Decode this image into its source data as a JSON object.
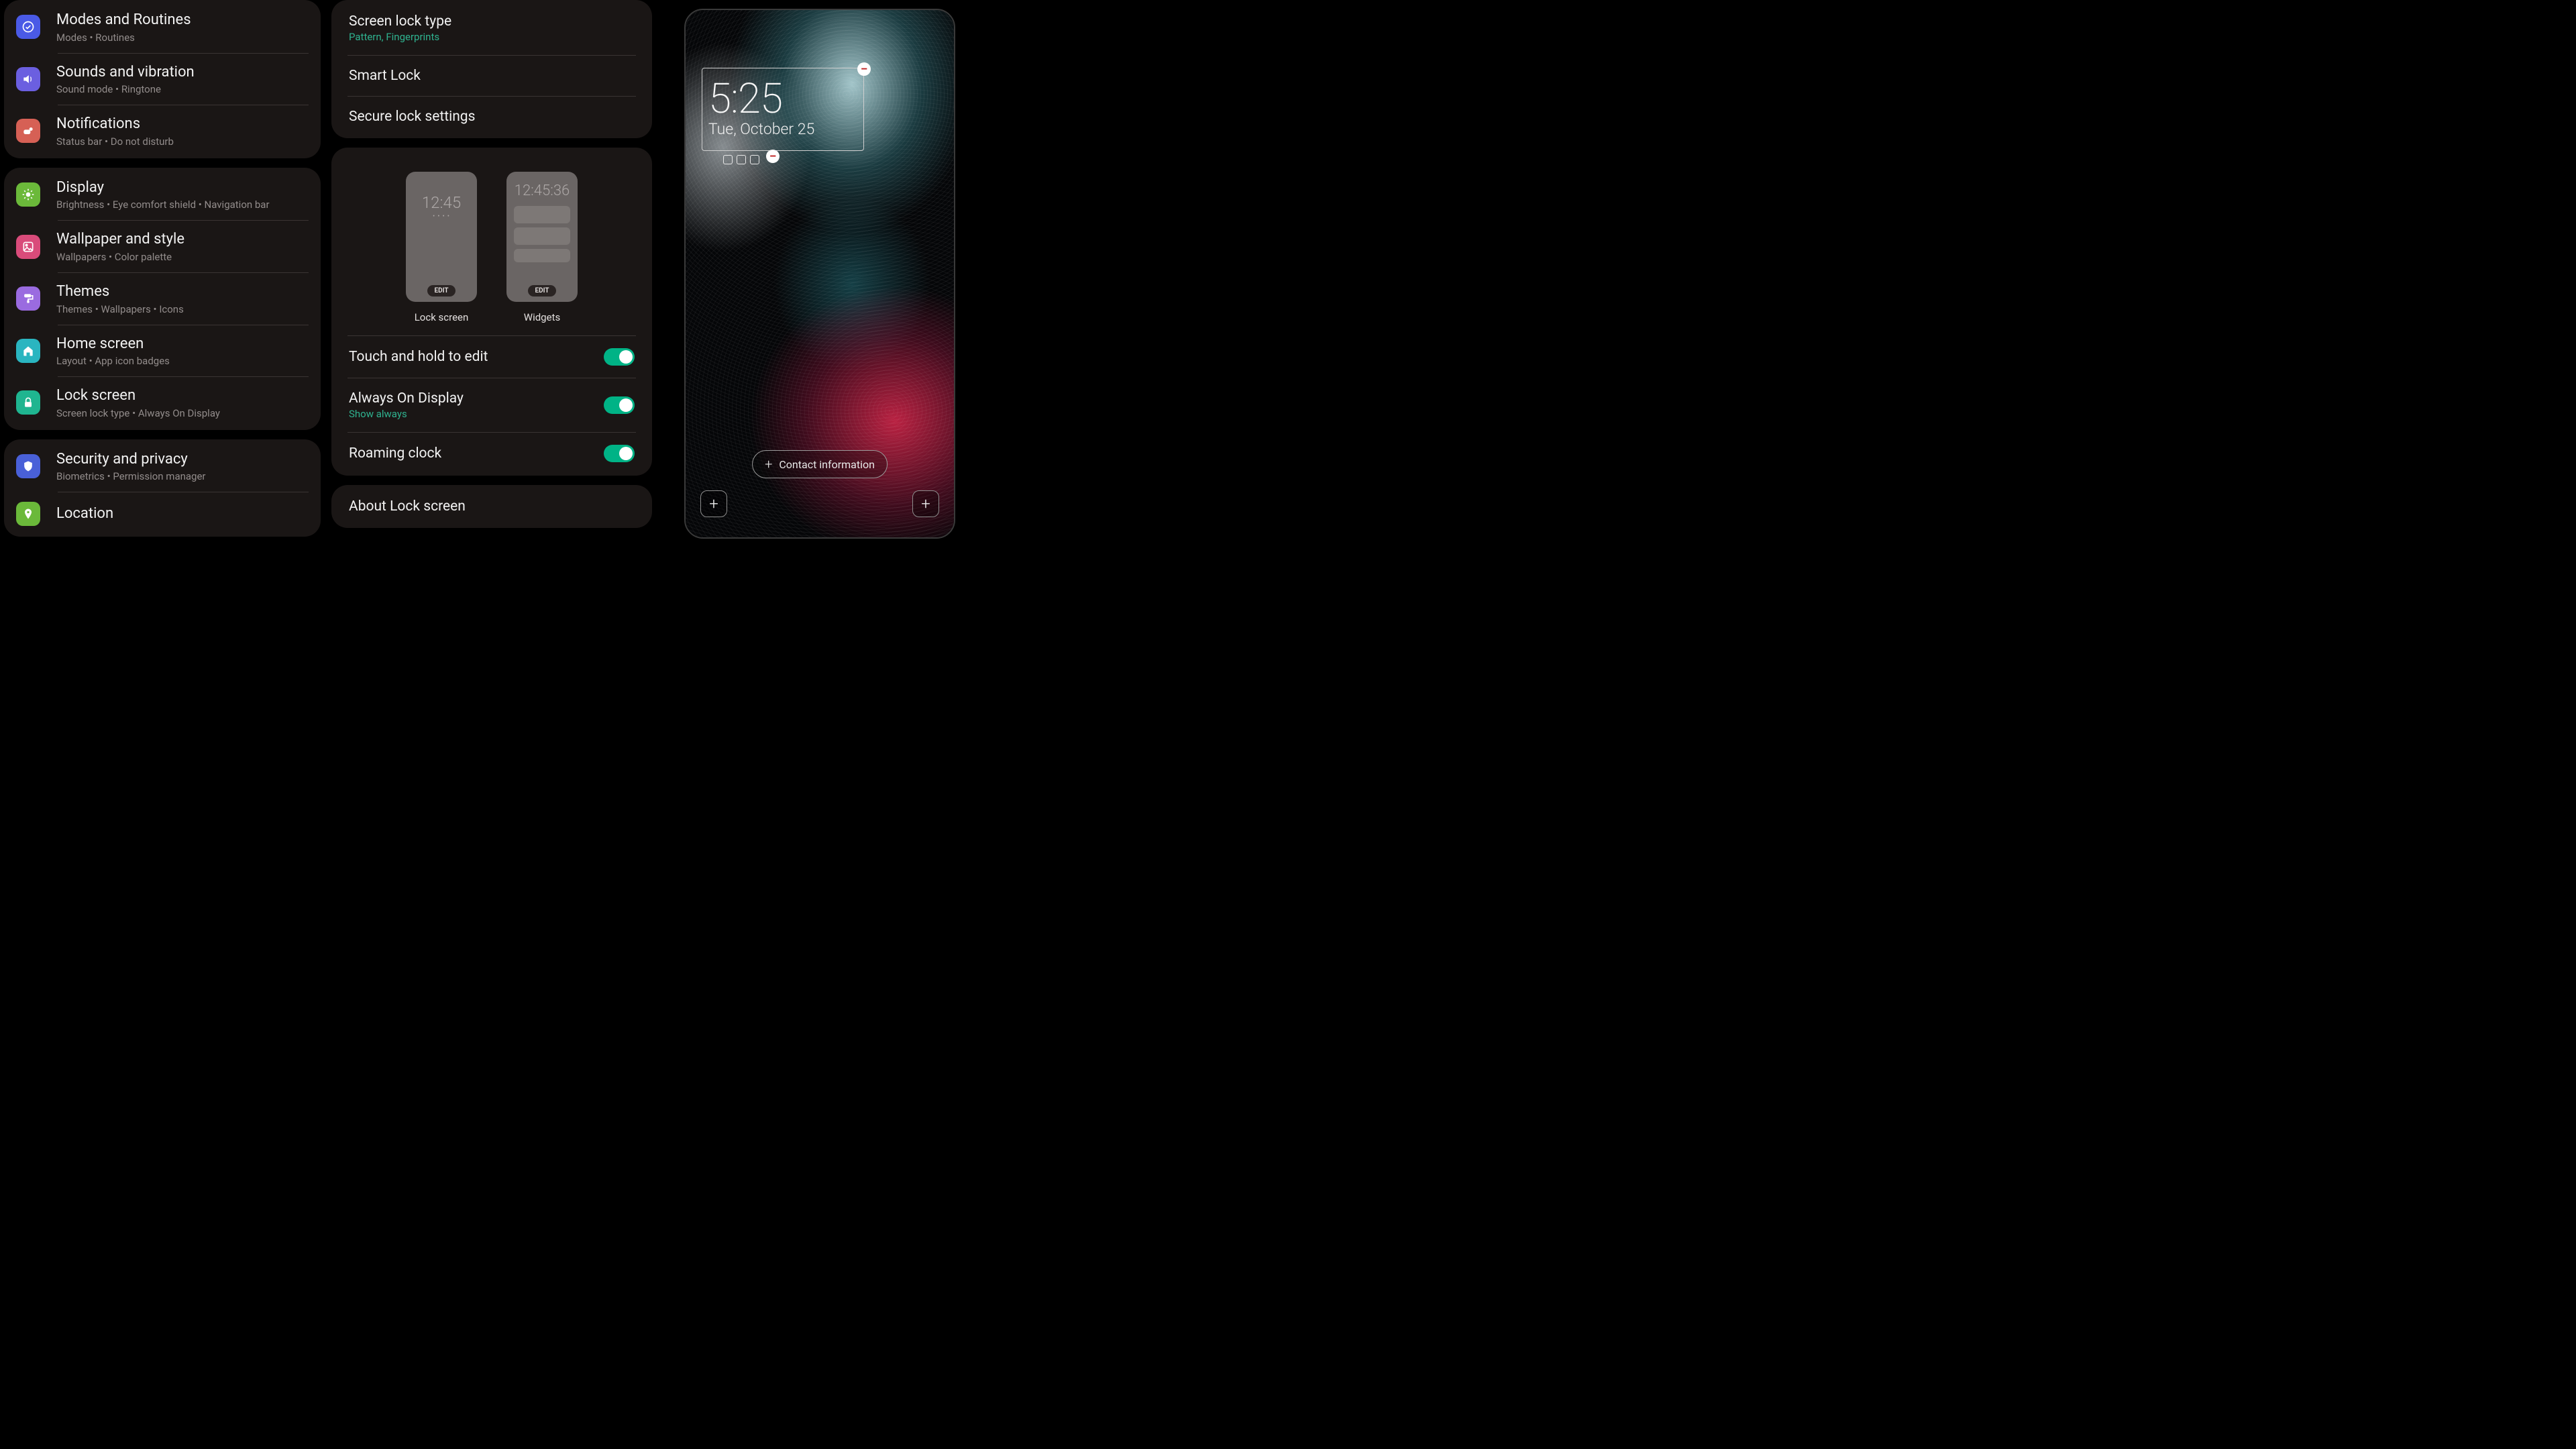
{
  "settings": {
    "group1": [
      {
        "title": "Modes and Routines",
        "subtitle": "Modes  •  Routines"
      },
      {
        "title": "Sounds and vibration",
        "subtitle": "Sound mode  •  Ringtone"
      },
      {
        "title": "Notifications",
        "subtitle": "Status bar  •  Do not disturb"
      }
    ],
    "group2": [
      {
        "title": "Display",
        "subtitle": "Brightness  •  Eye comfort shield  •  Navigation bar"
      },
      {
        "title": "Wallpaper and style",
        "subtitle": "Wallpapers  •  Color palette"
      },
      {
        "title": "Themes",
        "subtitle": "Themes  •  Wallpapers  •  Icons"
      },
      {
        "title": "Home screen",
        "subtitle": "Layout  •  App icon badges"
      },
      {
        "title": "Lock screen",
        "subtitle": "Screen lock type  •  Always On Display"
      }
    ],
    "group3": [
      {
        "title": "Security and privacy",
        "subtitle": "Biometrics  •  Permission manager"
      },
      {
        "title": "Location",
        "subtitle": ""
      }
    ]
  },
  "lockSettings": {
    "screenLockType": {
      "title": "Screen lock type",
      "value": "Pattern, Fingerprints"
    },
    "smartLock": "Smart Lock",
    "secureLock": "Secure lock settings",
    "previews": {
      "lock": {
        "time": "12:45",
        "edit": "EDIT",
        "label": "Lock screen"
      },
      "widgets": {
        "time": "12:45:36",
        "edit": "EDIT",
        "label": "Widgets"
      }
    },
    "touchHold": {
      "title": "Touch and hold to edit",
      "on": true
    },
    "aod": {
      "title": "Always On Display",
      "value": "Show always",
      "on": true
    },
    "roaming": {
      "title": "Roaming clock",
      "on": true
    },
    "about": "About Lock screen"
  },
  "lockscreen": {
    "time": "5:25",
    "date": "Tue, October 25",
    "contactInfo": "Contact information",
    "plus": "+",
    "minus": "–"
  }
}
